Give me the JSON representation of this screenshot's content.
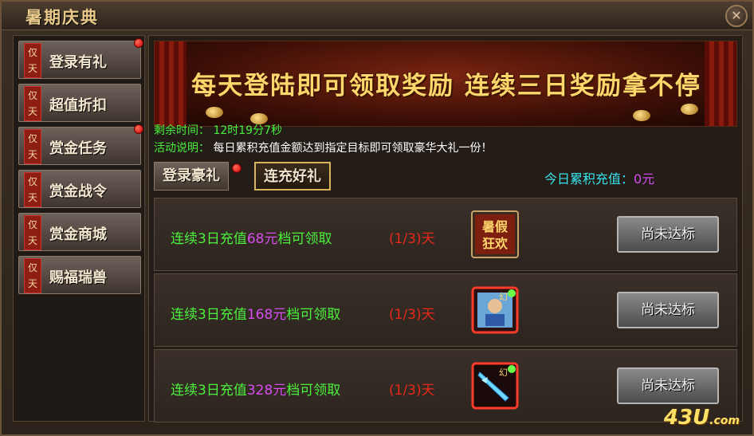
{
  "window": {
    "title": "暑期庆典",
    "close_label": "✕"
  },
  "sidebar": {
    "tag_text": "仅天",
    "items": [
      {
        "label": "登录有礼",
        "has_notice": true
      },
      {
        "label": "超值折扣",
        "has_notice": false
      },
      {
        "label": "赏金任务",
        "has_notice": true
      },
      {
        "label": "赏金战令",
        "has_notice": false
      },
      {
        "label": "赏金商城",
        "has_notice": false
      },
      {
        "label": "赐福瑞兽",
        "has_notice": false
      }
    ]
  },
  "banner": {
    "headline": "每天登陆即可领取奖励 连续三日奖励拿不停"
  },
  "info": {
    "time_label": "剩余时间：",
    "time_value": "12时19分7秒",
    "desc_label": "活动说明：",
    "desc_value": "每日累积充值金额达到指定目标即可领取豪华大礼一份！"
  },
  "tabs": [
    {
      "label": "登录豪礼",
      "active": false,
      "has_notice": true
    },
    {
      "label": "连充好礼",
      "active": true,
      "has_notice": false
    }
  ],
  "today_total": {
    "label": "今日累积充值：",
    "amount": "0元"
  },
  "rewards": [
    {
      "prefix": "连续3日充值",
      "amount": "68元",
      "suffix": "档可领取",
      "progress": "(1/3)天",
      "item_icon": "summer-carnival-scroll-icon",
      "button_label": "尚未达标"
    },
    {
      "prefix": "连续3日充值",
      "amount": "168元",
      "suffix": "档可领取",
      "progress": "(1/3)天",
      "item_icon": "illusion-character-card-icon",
      "item_badge": "幻",
      "button_label": "尚未达标"
    },
    {
      "prefix": "连续3日充值",
      "amount": "328元",
      "suffix": "档可领取",
      "progress": "(1/3)天",
      "item_icon": "illusion-blade-icon",
      "item_badge": "幻",
      "button_label": "尚未达标"
    }
  ],
  "watermark": {
    "text": "43U",
    "sub": ".com"
  },
  "colors": {
    "highlight_green": "#4cf03d",
    "amount_magenta": "#d64cf0",
    "progress_red": "#e8291a",
    "total_cyan": "#37e3ee",
    "banner_gold": "#ffd66b"
  }
}
